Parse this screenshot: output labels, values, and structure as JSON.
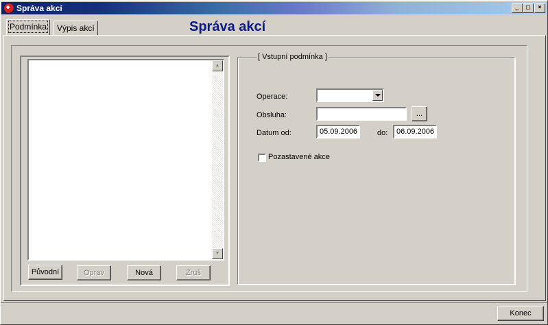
{
  "window": {
    "title": "Správa akcí",
    "buttons": {
      "minimize": "_",
      "maximize": "□",
      "close": "×"
    }
  },
  "tabs": [
    {
      "label": "Podmínka",
      "active": true
    },
    {
      "label": "Výpis akcí",
      "active": false
    }
  ],
  "page_title": "Správa akcí",
  "left_buttons": {
    "puvodni": "Původní",
    "oprav": "Oprav",
    "nova": "Nová",
    "zrus": "Zruš"
  },
  "condition": {
    "legend": "[ Vstupní podmínka ]",
    "operace_label": "Operace:",
    "operace_value": "",
    "obsluha_label": "Obsluha:",
    "obsluha_value": "",
    "browse_label": "...",
    "datum_od_label": "Datum od:",
    "datum_od_value": "05.09.2006",
    "do_label": "do:",
    "do_value": "06.09.2006",
    "pozastavene_label": "Pozastavené akce",
    "pozastavene_checked": false
  },
  "footer": {
    "konec": "Konec"
  }
}
